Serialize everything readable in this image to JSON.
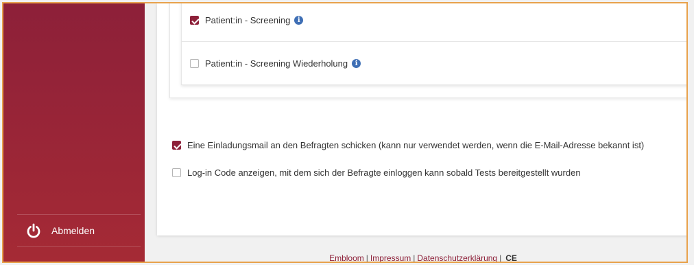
{
  "sidebar": {
    "logout_label": "Abmelden",
    "logout_icon": "power-icon",
    "accent_color": "#8d2039"
  },
  "tests": [
    {
      "label": "Patient:in - Screening",
      "checked": true,
      "info_icon": "info-icon"
    },
    {
      "label": "Patient:in - Screening Wiederholung",
      "checked": false,
      "info_icon": "info-icon"
    }
  ],
  "options": {
    "send_invite": {
      "label": "Eine Einladungsmail an den Befragten schicken (kann nur verwendet werden, wenn die E-Mail-Adresse bekannt ist)",
      "checked": true
    },
    "show_login_code": {
      "label": "Log-in Code anzeigen, mit dem sich der Befragte einloggen kann sobald Tests bereitgestellt wurden",
      "checked": false
    }
  },
  "footer": {
    "brand": "Embloom",
    "separator": "|",
    "impressum": "Impressum",
    "privacy": "Datenschutzerklärung",
    "ce_mark": "CE"
  }
}
